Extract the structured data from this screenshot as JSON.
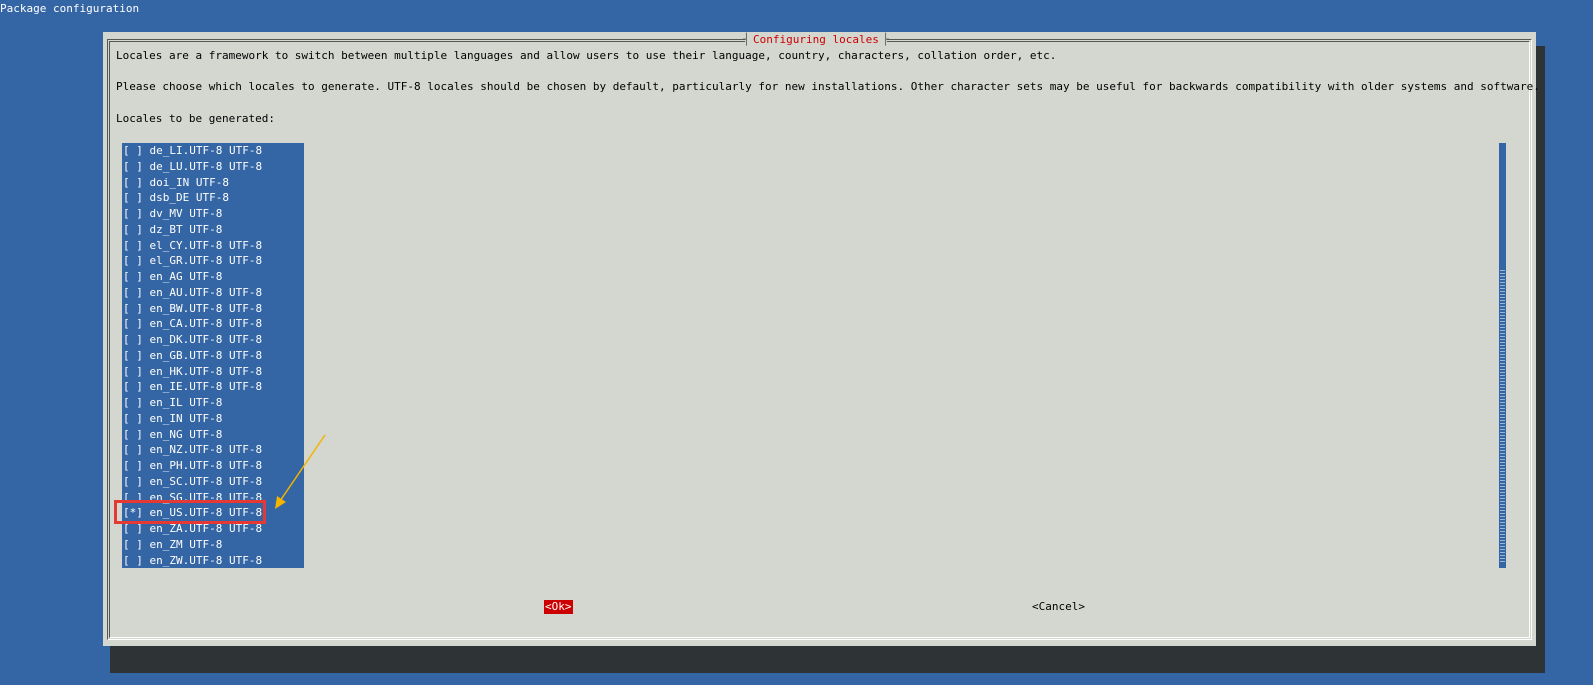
{
  "window": {
    "title": "Package configuration"
  },
  "dialog": {
    "title": "Configuring locales",
    "description_lines": [
      "Locales are a framework to switch between multiple languages and allow users to use their language, country, characters, collation order, etc.",
      "Please choose which locales to generate. UTF-8 locales should be chosen by default, particularly for new installations. Other character sets may be useful for backwards compatibility with older systems and software.",
      "Locales to be generated:"
    ]
  },
  "locales": [
    {
      "checkbox": "[ ]",
      "label": "de_LI.UTF-8 UTF-8"
    },
    {
      "checkbox": "[ ]",
      "label": "de_LU.UTF-8 UTF-8"
    },
    {
      "checkbox": "[ ]",
      "label": "doi_IN UTF-8"
    },
    {
      "checkbox": "[ ]",
      "label": "dsb_DE UTF-8"
    },
    {
      "checkbox": "[ ]",
      "label": "dv_MV UTF-8"
    },
    {
      "checkbox": "[ ]",
      "label": "dz_BT UTF-8"
    },
    {
      "checkbox": "[ ]",
      "label": "el_CY.UTF-8 UTF-8"
    },
    {
      "checkbox": "[ ]",
      "label": "el_GR.UTF-8 UTF-8"
    },
    {
      "checkbox": "[ ]",
      "label": "en_AG UTF-8"
    },
    {
      "checkbox": "[ ]",
      "label": "en_AU.UTF-8 UTF-8"
    },
    {
      "checkbox": "[ ]",
      "label": "en_BW.UTF-8 UTF-8"
    },
    {
      "checkbox": "[ ]",
      "label": "en_CA.UTF-8 UTF-8"
    },
    {
      "checkbox": "[ ]",
      "label": "en_DK.UTF-8 UTF-8"
    },
    {
      "checkbox": "[ ]",
      "label": "en_GB.UTF-8 UTF-8"
    },
    {
      "checkbox": "[ ]",
      "label": "en_HK.UTF-8 UTF-8"
    },
    {
      "checkbox": "[ ]",
      "label": "en_IE.UTF-8 UTF-8"
    },
    {
      "checkbox": "[ ]",
      "label": "en_IL UTF-8"
    },
    {
      "checkbox": "[ ]",
      "label": "en_IN UTF-8"
    },
    {
      "checkbox": "[ ]",
      "label": "en_NG UTF-8"
    },
    {
      "checkbox": "[ ]",
      "label": "en_NZ.UTF-8 UTF-8"
    },
    {
      "checkbox": "[ ]",
      "label": "en_PH.UTF-8 UTF-8"
    },
    {
      "checkbox": "[ ]",
      "label": "en_SC.UTF-8 UTF-8"
    },
    {
      "checkbox": "[ ]",
      "label": "en_SG.UTF-8 UTF-8"
    },
    {
      "checkbox": "[*]",
      "label": "en_US.UTF-8 UTF-8"
    },
    {
      "checkbox": "[ ]",
      "label": "en_ZA.UTF-8 UTF-8"
    },
    {
      "checkbox": "[ ]",
      "label": "en_ZM UTF-8"
    },
    {
      "checkbox": "[ ]",
      "label": "en_ZW.UTF-8 UTF-8"
    }
  ],
  "buttons": {
    "ok": "<Ok>",
    "cancel": "<Cancel>"
  },
  "annotation": {
    "box_color": "#e53935",
    "arrow_color": "#f4b400"
  }
}
